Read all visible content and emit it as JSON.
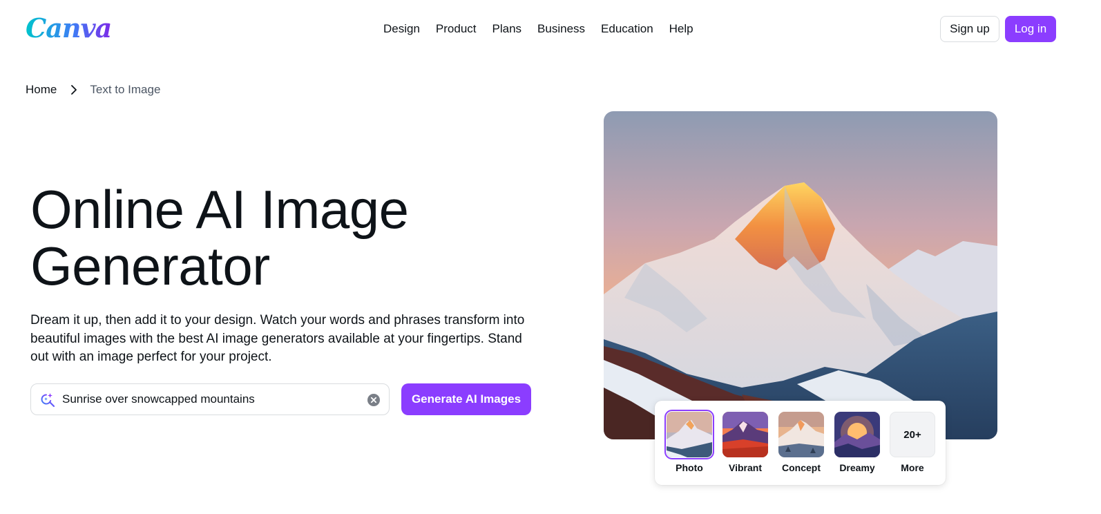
{
  "header": {
    "logo": "Canva",
    "nav": [
      "Design",
      "Product",
      "Plans",
      "Business",
      "Education",
      "Help"
    ],
    "signup_label": "Sign up",
    "login_label": "Log in"
  },
  "breadcrumb": {
    "home": "Home",
    "current": "Text to Image"
  },
  "hero": {
    "title_line1": "Online AI Image",
    "title_line2": "Generator",
    "description": "Dream it up, then add it to your design. Watch your words and phrases transform into beautiful images with the best AI image generators available at your fingertips. Stand out with an image perfect for your project."
  },
  "search": {
    "value": "Sunrise over snowcapped mountains",
    "button_label": "Generate AI Images"
  },
  "styles": [
    {
      "label": "Photo",
      "selected": true
    },
    {
      "label": "Vibrant",
      "selected": false
    },
    {
      "label": "Concept",
      "selected": false
    },
    {
      "label": "Dreamy",
      "selected": false
    },
    {
      "label": "More",
      "thumb_text": "20+",
      "selected": false
    }
  ],
  "colors": {
    "accent": "#8b3dff",
    "text": "#0e1318"
  },
  "icons": {
    "search": "sparkle-search-icon",
    "clear": "clear-circle-icon",
    "breadcrumb_separator": "chevron-right-icon"
  }
}
